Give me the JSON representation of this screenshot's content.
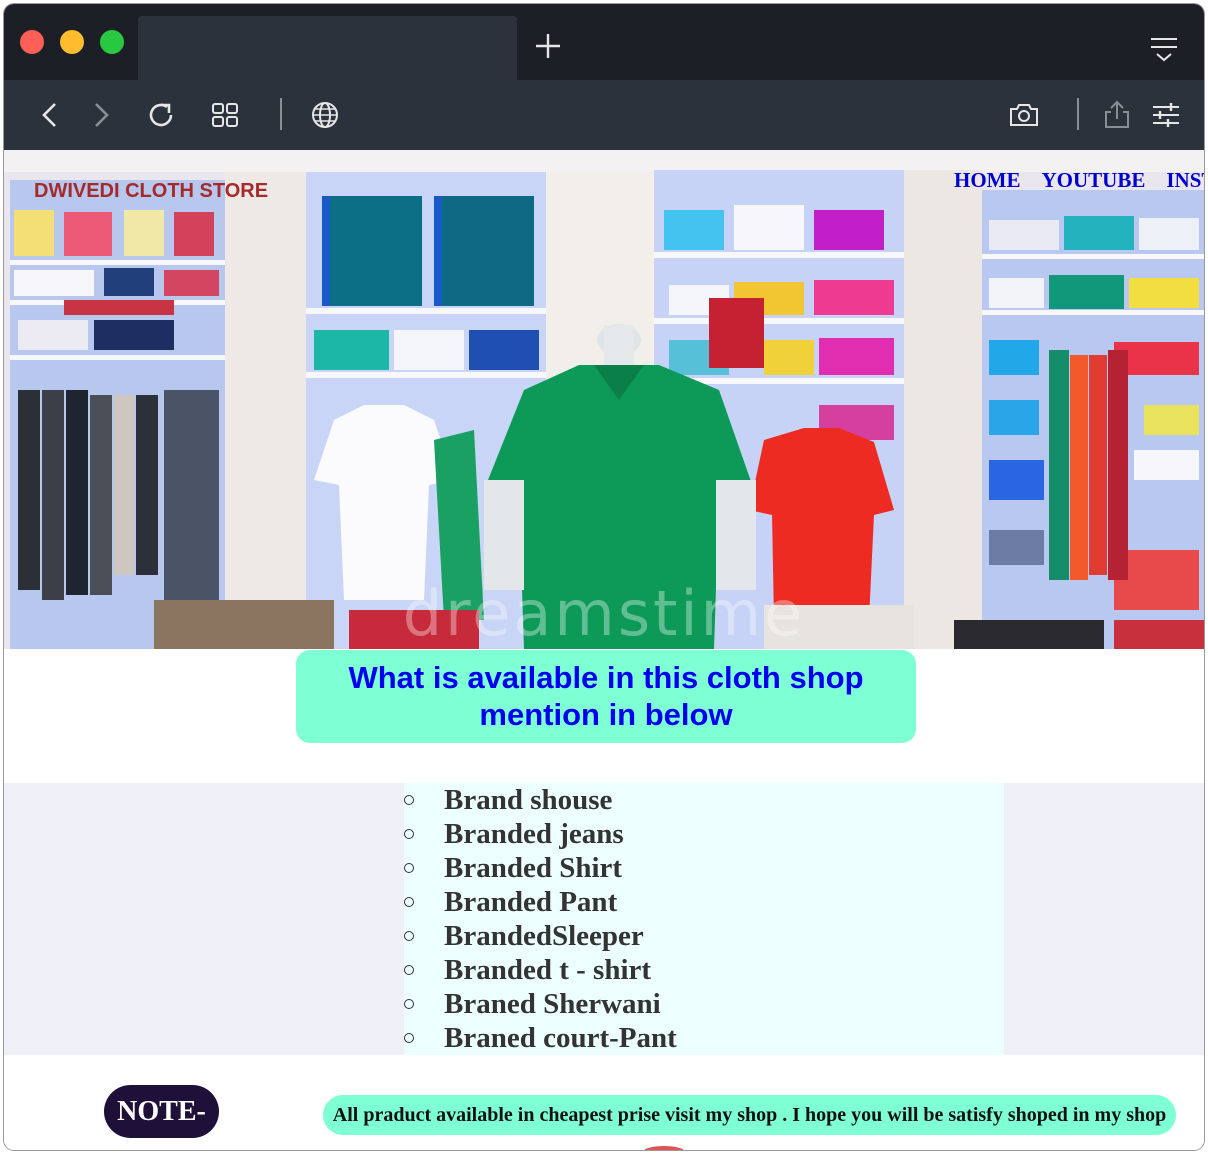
{
  "browser": {
    "tab_title": "",
    "icons": {
      "close": "close-traffic-light",
      "minimize": "minimize-traffic-light",
      "zoom": "zoom-traffic-light",
      "new_tab": "plus-icon",
      "tab_menu": "tab-list-icon",
      "back": "chevron-left-icon",
      "forward": "chevron-right-icon",
      "reload": "reload-icon",
      "tab_overview": "grid-icon",
      "site": "globe-icon",
      "screenshot": "camera-icon",
      "share": "share-icon",
      "settings": "sliders-icon"
    },
    "colors": {
      "tab_bar": "#1c2026",
      "toolbar": "#2c323c",
      "traffic_red": "#fe5f57",
      "traffic_yellow": "#febc2e",
      "traffic_green": "#28c840"
    }
  },
  "page": {
    "brand": "DWIVEDI CLOTH STORE",
    "nav": [
      "HOME",
      "YOUTUBE",
      "INSTAGRAM"
    ],
    "hero_image": "clothing-store-interior-photo",
    "headline": "What is available in this cloth shop mention in below",
    "products": [
      "Brand shouse",
      "Branded jeans",
      "Branded Shirt",
      "Branded Pant",
      "BrandedSleeper",
      "Branded t - shirt",
      "Braned Sherwani",
      "Braned court-Pant"
    ],
    "note_label": "NOTE-",
    "note_text": "All praduct available in cheapest prise visit my shop . I hope you will be satisfy shoped in my shop",
    "colors": {
      "brand": "#a52a2a",
      "nav": "#0000cc",
      "headline_bg": "#7fffd4",
      "headline_text": "#0000ee",
      "list_band": "#efeff8",
      "list_box": "#ecfefe",
      "note_badge": "#1e1039"
    }
  }
}
